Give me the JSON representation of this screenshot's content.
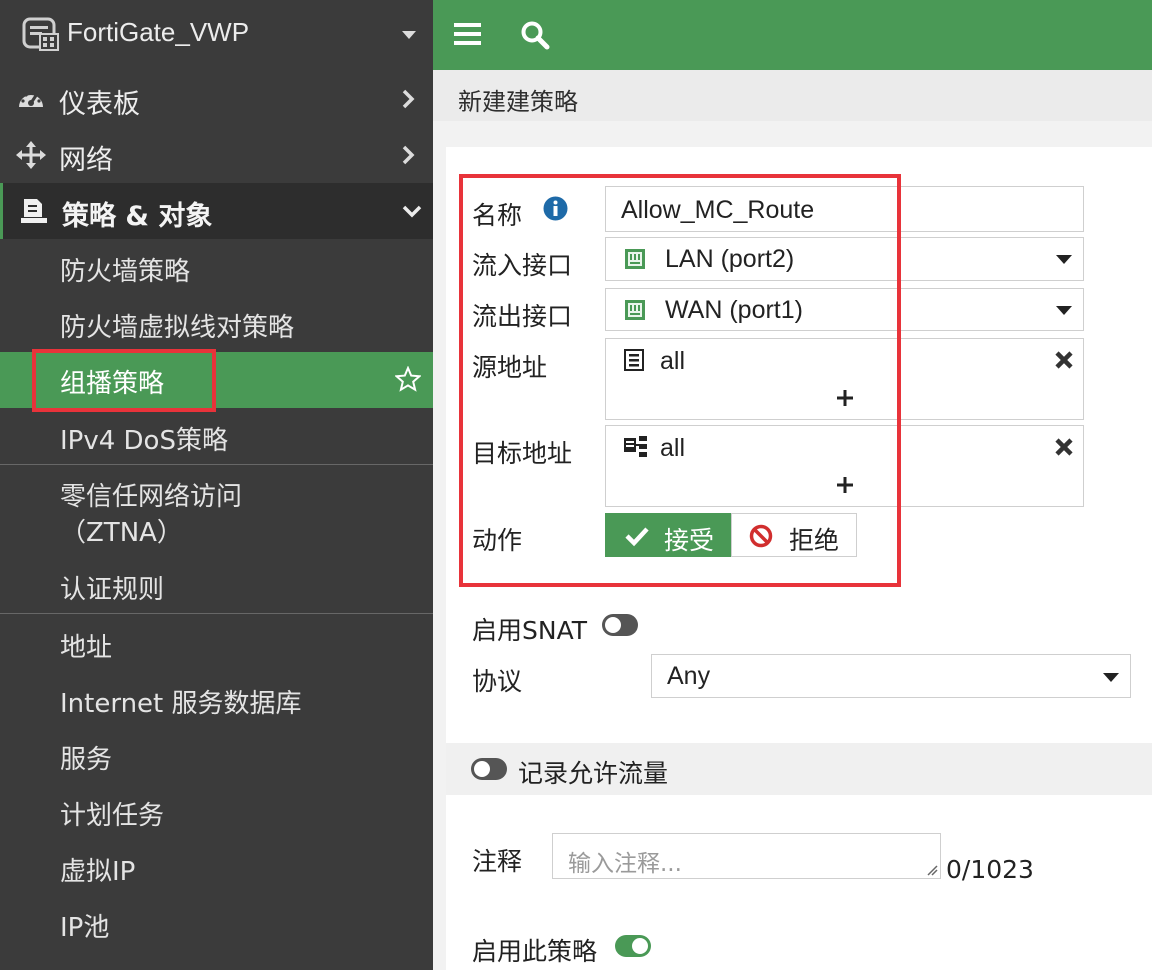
{
  "sidebar": {
    "device_name": "FortiGate_VWP",
    "top_items": {
      "dashboard": "仪表板",
      "network": "网络",
      "policy_objects": "策略 & 对象"
    },
    "sub_items": {
      "firewall_policy": "防火墙策略",
      "vwire_policy": "防火墙虚拟线对策略",
      "multicast_policy": "组播策略",
      "dos_policy": "IPv4 DoS策略",
      "ztna_line1": "零信任网络访问",
      "ztna_line2": "（ZTNA）",
      "auth_rules": "认证规则",
      "addresses": "地址",
      "isdb": "Internet 服务数据库",
      "services": "服务",
      "schedules": "计划任务",
      "vip": "虚拟IP",
      "ip_pools": "IP池"
    },
    "icons": [
      "gauge-icon",
      "arrows-move-icon",
      "policy-doc-icon",
      "chevron-right-icon",
      "chevron-down-icon",
      "star-icon"
    ]
  },
  "topbar": {
    "icons": [
      "hamburger-menu-icon",
      "search-icon"
    ]
  },
  "page": {
    "title": "新建建策略"
  },
  "form": {
    "name_label": "名称",
    "name_value": "Allow_MC_Route",
    "incoming_label": "流入接口",
    "incoming_value": "LAN (port2)",
    "outgoing_label": "流出接口",
    "outgoing_value": "WAN (port1)",
    "source_label": "源地址",
    "source_value": "all",
    "destination_label": "目标地址",
    "destination_value": "all",
    "action_label": "动作",
    "action_accept": "接受",
    "action_deny": "拒绝",
    "snat_label": "启用SNAT",
    "snat_enabled": false,
    "protocol_label": "协议",
    "protocol_value": "Any",
    "log_label": "记录允许流量",
    "log_enabled": false,
    "comment_label": "注释",
    "comment_placeholder": "输入注释...",
    "comment_count": "0/1023",
    "enable_label": "启用此策略",
    "policy_enabled": true
  },
  "colors": {
    "brand_green": "#4a9956",
    "sidebar_bg": "#3b3b3b",
    "highlight_red": "#e8333a",
    "info_blue": "#1e6aa8",
    "deny_red": "#d12e2e"
  }
}
